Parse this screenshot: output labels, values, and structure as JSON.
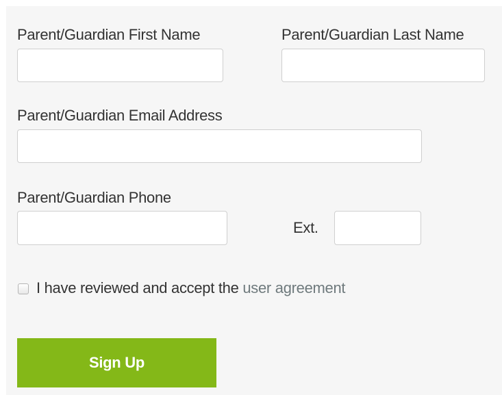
{
  "form": {
    "first_name": {
      "label": "Parent/Guardian First Name",
      "value": ""
    },
    "last_name": {
      "label": "Parent/Guardian Last Name",
      "value": ""
    },
    "email": {
      "label": "Parent/Guardian Email Address",
      "value": ""
    },
    "phone": {
      "label": "Parent/Guardian Phone",
      "value": ""
    },
    "ext": {
      "label": "Ext.",
      "value": ""
    },
    "agreement": {
      "text": "I have reviewed and accept the ",
      "link_text": "user agreement",
      "checked": false
    },
    "submit_label": "Sign Up"
  },
  "colors": {
    "panel_background": "#f6f6f6",
    "button_green": "#84b818",
    "link_gray": "#6f7a7d",
    "field_border": "#cfcfcf"
  }
}
